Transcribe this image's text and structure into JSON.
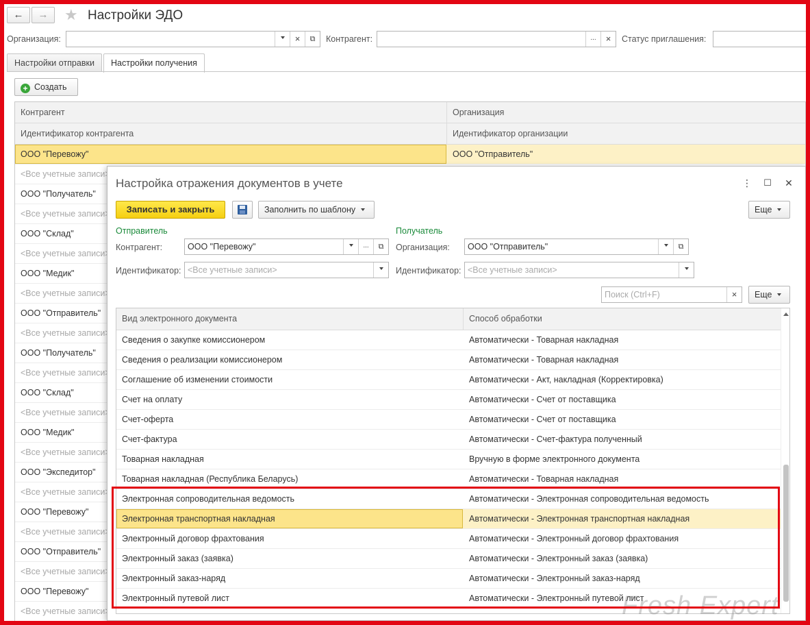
{
  "window": {
    "title": "Настройки ЭДО",
    "back_icon": "←",
    "forward_icon": "→",
    "star_icon": "★"
  },
  "filters": {
    "organization_label": "Организация:",
    "organization_value": "",
    "counterparty_label": "Контрагент:",
    "counterparty_value": "",
    "invite_status_label": "Статус приглашения:",
    "invite_status_value": "",
    "clear_glyph": "×",
    "open_glyph": "⧉",
    "more_glyph": "..."
  },
  "tabs": [
    {
      "label": "Настройки отправки",
      "active": false
    },
    {
      "label": "Настройки получения",
      "active": true
    }
  ],
  "toolbar": {
    "create_label": "Создать",
    "create_icon": "+"
  },
  "bg_table": {
    "col_counterparty": "Контрагент",
    "col_organization": "Организация",
    "col_counterparty_id": "Идентификатор контрагента",
    "col_organization_id": "Идентификатор организации",
    "selected_org": "ООО \"Отправитель\"",
    "rows": [
      "ООО \"Перевожу\"",
      "<Все учетные записи>",
      "ООО \"Получатель\"",
      "<Все учетные записи>",
      "ООО \"Склад\"",
      "<Все учетные записи>",
      "ООО \"Медик\"",
      "<Все учетные записи>",
      "ООО \"Отправитель\"",
      "<Все учетные записи>",
      "ООО \"Получатель\"",
      "<Все учетные записи>",
      "ООО \"Склад\"",
      "<Все учетные записи>",
      "ООО \"Медик\"",
      "<Все учетные записи>",
      "ООО \"Экспедитор\"",
      "<Все учетные записи>",
      "ООО \"Перевожу\"",
      "<Все учетные записи>",
      "ООО \"Отправитель\"",
      "<Все учетные записи>",
      "ООО \"Перевожу\"",
      "<Все учетные записи>"
    ]
  },
  "dialog": {
    "title": "Настройка отражения документов в учете",
    "menu_icon": "⋮",
    "maximize_icon": "☐",
    "close_icon": "✕",
    "save_close_label": "Записать и закрыть",
    "fill_template_label": "Заполнить по шаблону",
    "more_label": "Еще",
    "sender_section": "Отправитель",
    "receiver_section": "Получатель",
    "counterparty_label": "Контрагент:",
    "counterparty_value": "ООО \"Перевожу\"",
    "sender_id_label": "Идентификатор:",
    "sender_id_placeholder": "<Все учетные записи>",
    "organization_label": "Организация:",
    "organization_value": "ООО \"Отправитель\"",
    "receiver_id_label": "Идентификатор:",
    "receiver_id_placeholder": "<Все учетные записи>",
    "search_placeholder": "Поиск (Ctrl+F)",
    "search_more_label": "Еще",
    "table": {
      "col_doc_type": "Вид электронного документа",
      "col_processing": "Способ обработки",
      "rows": [
        {
          "doc": "Сведения о закупке комиссионером",
          "proc": "Автоматически -  Товарная накладная"
        },
        {
          "doc": "Сведения о реализации комиссионером",
          "proc": "Автоматически -  Товарная накладная"
        },
        {
          "doc": "Соглашение об изменении стоимости",
          "proc": "Автоматически -  Акт, накладная (Корректировка)"
        },
        {
          "doc": "Счет на оплату",
          "proc": "Автоматически -  Счет от поставщика"
        },
        {
          "doc": "Счет-оферта",
          "proc": "Автоматически -  Счет от поставщика"
        },
        {
          "doc": "Счет-фактура",
          "proc": "Автоматически -  Счет-фактура полученный"
        },
        {
          "doc": "Товарная накладная",
          "proc": "Вручную в форме электронного документа"
        },
        {
          "doc": "Товарная накладная (Республика Беларусь)",
          "proc": "Автоматически -  Товарная накладная"
        },
        {
          "doc": "Электронная сопроводительная ведомость",
          "proc": "Автоматически -  Электронная сопроводительная ведомость"
        },
        {
          "doc": "Электронная транспортная накладная",
          "proc": "Автоматически -  Электронная транспортная накладная",
          "selected": true
        },
        {
          "doc": "Электронный договор фрахтования",
          "proc": "Автоматически -  Электронный договор фрахтования"
        },
        {
          "doc": "Электронный заказ (заявка)",
          "proc": "Автоматически -  Электронный заказ (заявка)"
        },
        {
          "doc": "Электронный заказ-наряд",
          "proc": "Автоматически -  Электронный заказ-наряд"
        },
        {
          "doc": "Электронный путевой лист",
          "proc": "Автоматически -  Электронный путевой лист"
        }
      ]
    }
  },
  "watermark": "Fresh Expert",
  "colors": {
    "frame_border": "#e30613",
    "primary_button": "#f5cf12",
    "section_label": "#1a8a3a",
    "selection": "#fce48a"
  }
}
